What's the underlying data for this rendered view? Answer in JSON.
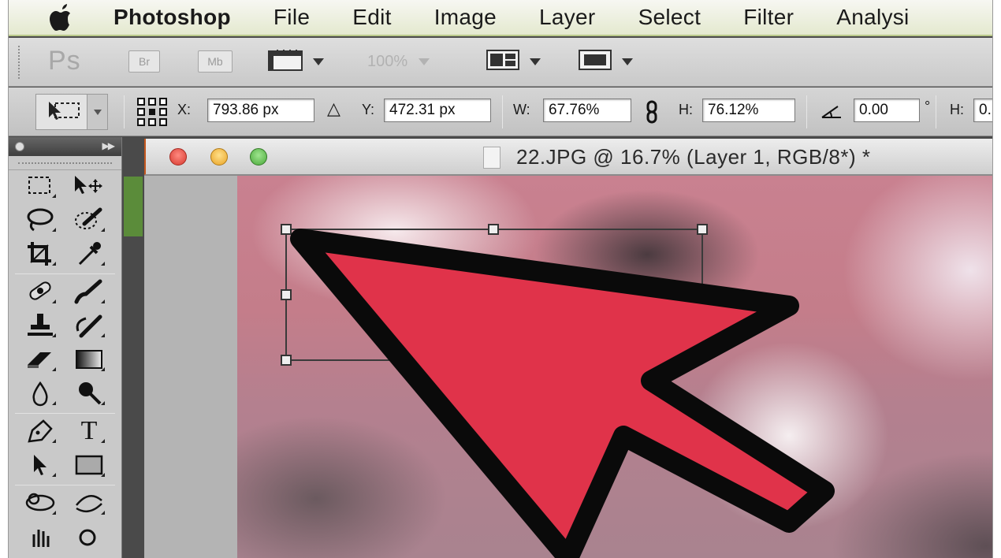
{
  "menubar": {
    "app_name": "Photoshop",
    "items": [
      {
        "label": "File"
      },
      {
        "label": "Edit"
      },
      {
        "label": "Image"
      },
      {
        "label": "Layer"
      },
      {
        "label": "Select"
      },
      {
        "label": "Filter"
      },
      {
        "label": "Analysi"
      }
    ]
  },
  "appbar": {
    "logo": "Ps",
    "bridge_label": "Br",
    "minibridge_label": "Mb",
    "zoom_value": "100%"
  },
  "options_bar": {
    "x_label": "X:",
    "x_value": "793.86 px",
    "delta_symbol": "△",
    "y_label": "Y:",
    "y_value": "472.31 px",
    "w_label": "W:",
    "w_value": "67.76%",
    "h_label": "H:",
    "h_value": "76.12%",
    "angle_value": "0.00",
    "degree_symbol": "°",
    "h2_label": "H:",
    "h2_value": "0."
  },
  "document": {
    "title": "22.JPG @ 16.7% (Layer 1, RGB/8*) *"
  },
  "tools_panel": {
    "type_tool_glyph": "T"
  },
  "colors": {
    "arrow_fill": "#e0334a",
    "arrow_outline": "#0a0a0a",
    "close_button": "#e54a3f",
    "minimize_button": "#f4b93b",
    "zoom_button": "#5fbf4e"
  }
}
